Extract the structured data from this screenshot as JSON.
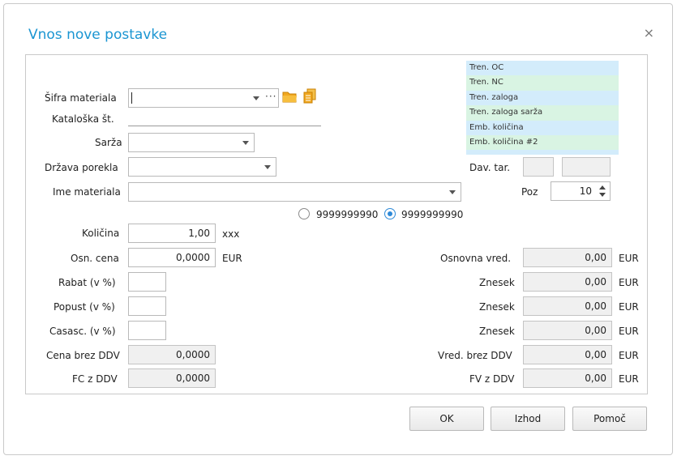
{
  "dialog": {
    "title": "Vnos nove postavke",
    "close": "×"
  },
  "labels": {
    "sifra": "Šifra materiala",
    "kataloska": "Kataloška št.",
    "sarza": "Sarža",
    "drzava": "Država porekla",
    "ime": "Ime materiala",
    "kolicina": "Količina",
    "osn_cena": "Osn. cena",
    "rabat": "Rabat (v %)",
    "popust": "Popust (v %)",
    "casasc": "Casasc. (v %)",
    "cena_brez": "Cena brez DDV",
    "fc_z": "FC z DDV",
    "dav_tar": "Dav. tar.",
    "poz": "Poz",
    "osnovna_vred": "Osnovna vred.",
    "znesek1": "Znesek",
    "znesek2": "Znesek",
    "znesek3": "Znesek",
    "vred_brez": "Vred. brez DDV",
    "fv_z": "FV z DDV"
  },
  "values": {
    "kolicina": "1,00",
    "kolicina_unit": "xxx",
    "osn_cena": "0,0000",
    "osn_cena_unit": "EUR",
    "cena_brez": "0,0000",
    "fc_z": "0,0000",
    "poz": "10",
    "osnovna_vred": "0,00",
    "znesek1": "0,00",
    "znesek2": "0,00",
    "znesek3": "0,00",
    "vred_brez": "0,00",
    "fv_z": "0,00",
    "currency": "EUR"
  },
  "radio": {
    "option1": "9999999990",
    "option2": "9999999990",
    "selected": 2
  },
  "stock_info": [
    "Tren. OC",
    "Tren. NC",
    "Tren. zaloga",
    "Tren. zaloga sarža",
    "Emb. količina",
    "Emb. količina #2",
    "..."
  ],
  "sifra_more": "···",
  "buttons": {
    "ok": "OK",
    "izhod": "Izhod",
    "pomoc": "Pomoč"
  },
  "icons": {
    "dropdown": "chevron-down-icon",
    "folder": "folder-icon",
    "copy": "copy-icon"
  },
  "colors": {
    "title": "#1a95d2",
    "stock_blue": "#d3ecfb",
    "stock_green": "#d9f4e3",
    "radio": "#2e8ad8"
  }
}
